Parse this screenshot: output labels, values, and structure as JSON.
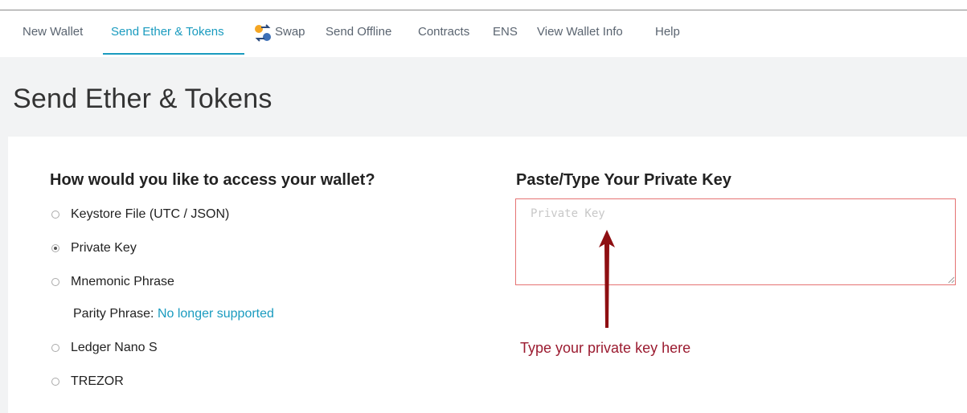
{
  "nav": {
    "items": [
      "New Wallet",
      "Send Ether & Tokens",
      "Swap",
      "Send Offline",
      "Contracts",
      "ENS",
      "View Wallet Info",
      "Help"
    ]
  },
  "page_title": "Send Ether & Tokens",
  "access": {
    "heading": "How would you like to access your wallet?",
    "options": [
      "Keystore File (UTC / JSON)",
      "Private Key",
      "Mnemonic Phrase",
      "Ledger Nano S",
      "TREZOR"
    ],
    "selected": "Private Key",
    "parity_label": "Parity Phrase:",
    "parity_link": "No longer supported"
  },
  "private_key": {
    "heading": "Paste/Type Your Private Key",
    "placeholder": "Private Key",
    "value": ""
  },
  "annotation": "Type your private key here",
  "colors": {
    "accent": "#1a9bbf",
    "annotation": "#9b1b30",
    "input_border": "#e57373"
  }
}
